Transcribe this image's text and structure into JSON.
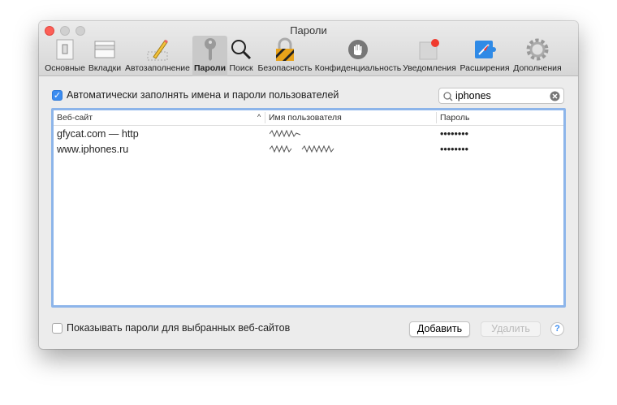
{
  "window": {
    "title": "Пароли"
  },
  "toolbar": [
    {
      "label": "Основные",
      "icon": "general-switch-icon"
    },
    {
      "label": "Вкладки",
      "icon": "tabs-icon"
    },
    {
      "label": "Автозаполнение",
      "icon": "autofill-pencil-icon"
    },
    {
      "label": "Пароли",
      "icon": "key-icon",
      "selected": true
    },
    {
      "label": "Поиск",
      "icon": "magnifier-icon"
    },
    {
      "label": "Безопасность",
      "icon": "padlock-icon"
    },
    {
      "label": "Конфиденциальность",
      "icon": "hand-icon"
    },
    {
      "label": "Уведомления",
      "icon": "notification-icon"
    },
    {
      "label": "Расширения",
      "icon": "puzzle-compass-icon"
    },
    {
      "label": "Дополнения",
      "icon": "gear-icon"
    }
  ],
  "autofill": {
    "label": "Автоматически заполнять имена и пароли пользователей",
    "checked": true
  },
  "search": {
    "value": "iphones"
  },
  "table": {
    "columns": [
      "Веб-сайт",
      "Имя пользователя",
      "Пароль"
    ],
    "rows": [
      {
        "site": "gfycat.com — http",
        "password": "••••••••"
      },
      {
        "site": "www.iphones.ru",
        "password": "••••••••"
      }
    ]
  },
  "footer": {
    "show_passwords": "Показывать пароли для выбранных веб-сайтов",
    "add": "Добавить",
    "remove": "Удалить",
    "help": "?"
  },
  "colors": {
    "accent": "#3b8cf0",
    "close": "#fc5f57"
  }
}
